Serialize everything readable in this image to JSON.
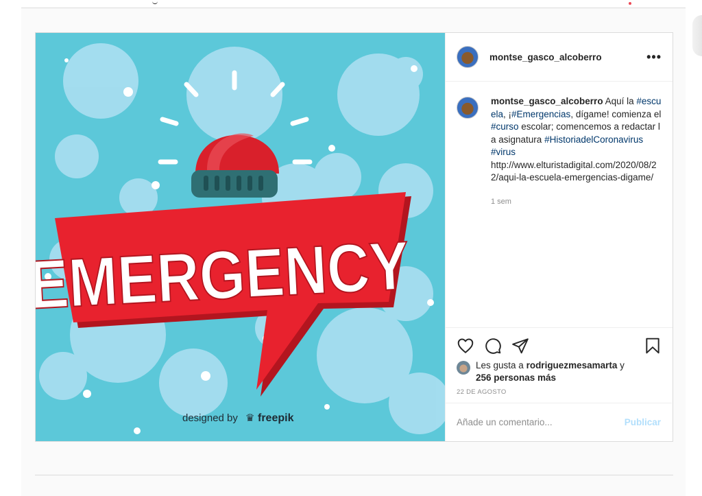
{
  "post": {
    "username": "montse_gasco_alcoberro",
    "more_label": "•••",
    "caption": {
      "username": "montse_gasco_alcoberro",
      "t1": " Aquí la ",
      "tag1": "#escuela",
      "t2": ", ¡",
      "tag2": "#Emergencias",
      "t3": ", dígame! comienza el ",
      "tag3": "#curso",
      "t4": " escolar; comencemos a redactar la asignatura ",
      "tag4": "#HistoriadelCoronavirus",
      "tag5": "#virus",
      "url": "http://www.elturistadigital.com/2020/08/22/aqui-la-escuela-emergencias-digame/"
    },
    "time_ago": "1 sem",
    "likes": {
      "prefix": "Les gusta a ",
      "user": "rodriguezmesamarta",
      "joiner": " y",
      "others": "256 personas más"
    },
    "date": "22 DE AGOSTO",
    "comment_placeholder": "Añade un comentario...",
    "publish_label": "Publicar",
    "image": {
      "headline": "EMERGENCY",
      "credit_prefix": "designed by",
      "credit_brand": "freepik"
    },
    "icons": [
      "heart-icon",
      "comment-icon",
      "share-icon",
      "save-icon"
    ]
  },
  "colors": {
    "link": "#00376b",
    "publish_disabled": "#b2dffc",
    "muted": "#8e8e8e",
    "image_bg": "#5cc8d9",
    "siren_red": "#d9202b"
  }
}
